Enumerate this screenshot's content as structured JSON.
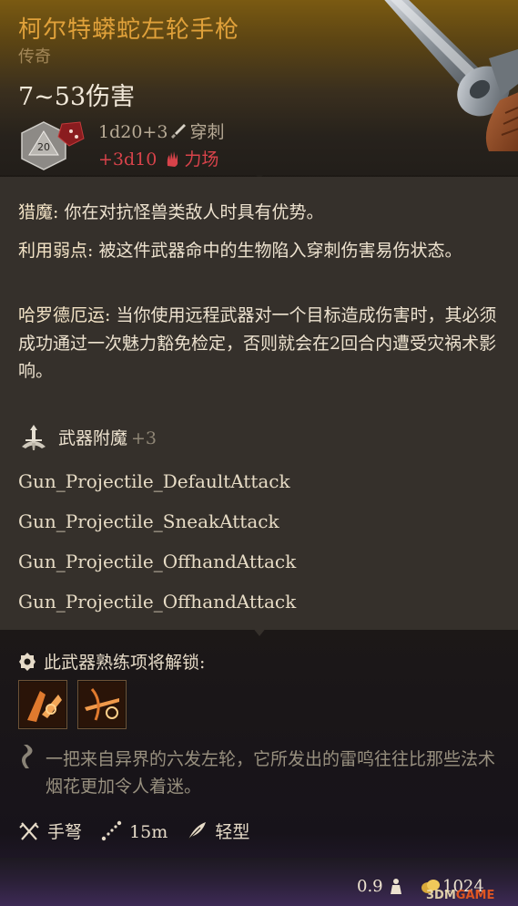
{
  "item": {
    "name": "柯尔特蟒蛇左轮手枪",
    "rarity": "传奇",
    "damage_range": "7~53伤害",
    "dice_icon": "d20-dice-icon",
    "damage_base": "1d20+3",
    "damage_base_type": "穿刺",
    "damage_extra": "+3d10",
    "damage_extra_type": "力场"
  },
  "passives": [
    {
      "name": "猎魔:",
      "text": " 你在对抗怪兽类敌人时具有优势。"
    },
    {
      "name": "利用弱点:",
      "text": " 被这件武器命中的生物陷入穿刺伤害易伤状态。"
    },
    {
      "name": "哈罗德厄运:",
      "text": " 当你使用远程武器对一个目标造成伤害时，其必须成功通过一次魅力豁免检定，否则就会在2回合内遭受灾祸术影响。"
    }
  ],
  "enchantment": {
    "label": "武器附魔",
    "bonus": "+3"
  },
  "projectiles": [
    "Gun_Projectile_DefaultAttack",
    "Gun_Projectile_SneakAttack",
    "Gun_Projectile_OffhandAttack",
    "Gun_Projectile_OffhandAttack"
  ],
  "proficiency": {
    "label": "此武器熟练项将解锁:",
    "skills": [
      "skill-mark-icon",
      "skill-crossbow-shot-icon"
    ]
  },
  "flavor": "一把来自异界的六发左轮，它所发出的雷鸣往往比那些法术烟花更加令人着迷。",
  "stats": {
    "type": "手弩",
    "range": "15m",
    "weight_class": "轻型"
  },
  "footer": {
    "weight": "0.9",
    "price": "1024"
  },
  "watermark": {
    "a": "3DM",
    "b": "GAME"
  },
  "colors": {
    "title": "#e0a13a",
    "force": "#d8434a",
    "panel": "#35302b"
  }
}
